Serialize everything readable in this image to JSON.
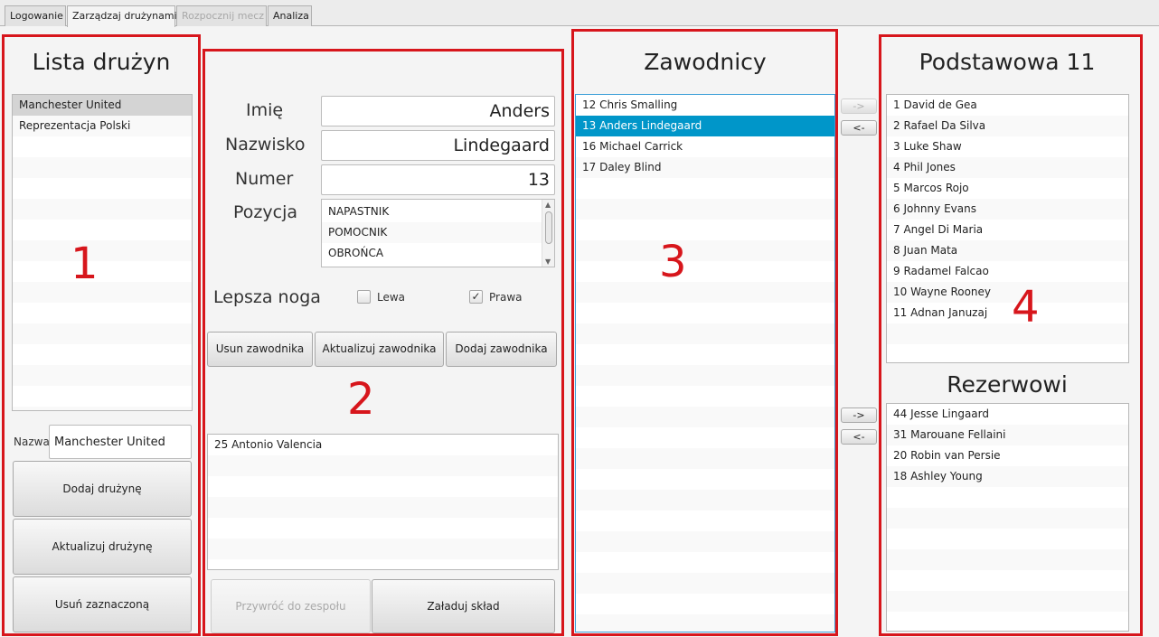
{
  "tabs": [
    {
      "label": "Logowanie"
    },
    {
      "label": "Zarządzaj drużynami"
    },
    {
      "label": "Rozpocznij mecz"
    },
    {
      "label": "Analiza"
    }
  ],
  "panel1": {
    "title": "Lista drużyn",
    "teams": [
      "Manchester United",
      "Reprezentacja Polski"
    ],
    "selected_team_index": 0,
    "name_label": "Nazwa",
    "name_value": "Manchester United",
    "add_button": "Dodaj drużynę",
    "update_button": "Aktualizuj drużynę",
    "delete_button": "Usuń zaznaczoną",
    "annotation": "1"
  },
  "panel2": {
    "first_name_label": "Imię",
    "first_name_value": "Anders",
    "last_name_label": "Nazwisko",
    "last_name_value": "Lindegaard",
    "number_label": "Numer",
    "number_value": "13",
    "position_label": "Pozycja",
    "positions": [
      "NAPASTNIK",
      "POMOCNIK",
      "OBROŃCA"
    ],
    "foot_label": "Lepsza noga",
    "left_foot": {
      "label": "Lewa",
      "checked": false
    },
    "right_foot": {
      "label": "Prawa",
      "checked": true
    },
    "remove_player_button": "Usun zawodnika",
    "update_player_button": "Aktualizuj zawodnika",
    "add_player_button": "Dodaj zawodnika",
    "removed_players": [
      "25 Antonio Valencia"
    ],
    "restore_button": "Przywróć do zespołu",
    "load_squad_button": "Załaduj skład",
    "annotation": "2"
  },
  "panel3": {
    "title": "Zawodnicy",
    "players": [
      "12 Chris Smalling",
      "13 Anders  Lindegaard",
      "16 Michael Carrick",
      "17 Daley Blind"
    ],
    "selected_player_index": 1,
    "annotation": "3"
  },
  "transfer_buttons": {
    "to_first_eleven": "->",
    "from_first_eleven": "<-",
    "to_reserves": "->",
    "from_reserves": "<-"
  },
  "panel4": {
    "first_eleven_title": "Podstawowa 11",
    "first_eleven": [
      "1 David de Gea",
      "2 Rafael Da Silva",
      "3 Luke Shaw",
      "4 Phil Jones",
      "5 Marcos Rojo",
      "6 Johnny Evans",
      "7 Angel Di Maria",
      "8 Juan Mata",
      "9 Radamel Falcao",
      "10 Wayne Rooney",
      "11 Adnan Januzaj"
    ],
    "reserves_title": "Rezerwowi",
    "reserves": [
      "44 Jesse Lingaard",
      "31 Marouane Fellaini",
      "20 Robin van Persie",
      "18 Ashley Young"
    ],
    "annotation": "4"
  },
  "colors": {
    "annotation_red": "#d7161c",
    "selection_blue": "#0096c9",
    "selection_grey": "#d4d4d4"
  }
}
